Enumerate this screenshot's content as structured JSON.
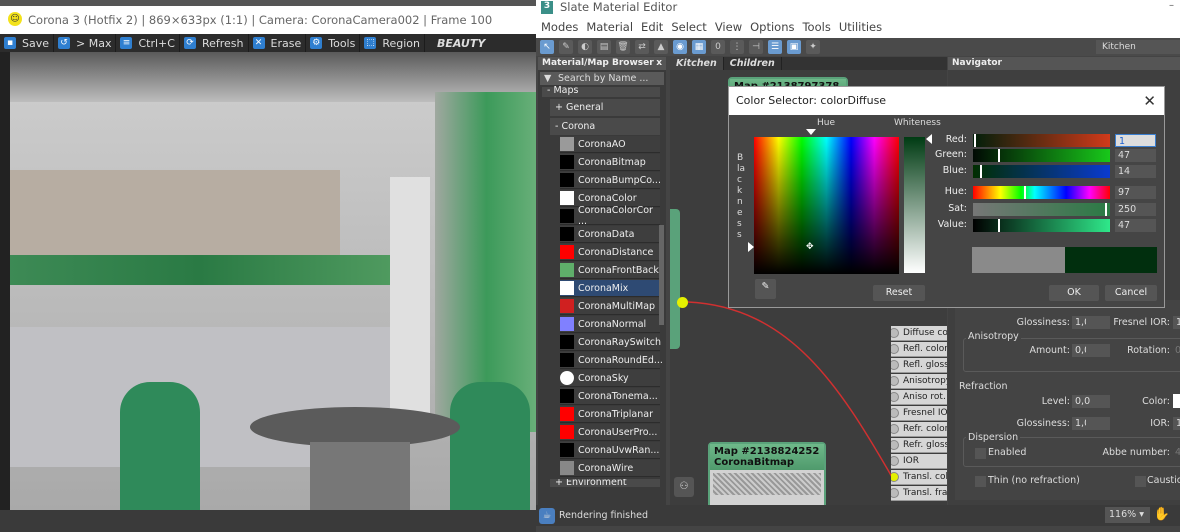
{
  "vfb": {
    "title": "Corona 3 (Hotfix 2) | 869×633px (1:1) | Camera: CoronaCamera002 | Frame 100",
    "toolbar": [
      {
        "label": "Save",
        "icon": "floppy-icon"
      },
      {
        "label": "> Max",
        "icon": "history-icon"
      },
      {
        "label": "Ctrl+C",
        "icon": "clipboard-icon"
      },
      {
        "label": "Refresh",
        "icon": "refresh-icon"
      },
      {
        "label": "Erase",
        "icon": "erase-icon"
      },
      {
        "label": "Tools",
        "icon": "gear-icon"
      },
      {
        "label": "Region",
        "icon": "region-icon"
      }
    ],
    "channel": "BEAUTY"
  },
  "sme": {
    "title": "Slate Material Editor",
    "menu": [
      "Modes",
      "Material",
      "Edit",
      "Select",
      "View",
      "Options",
      "Tools",
      "Utilities"
    ],
    "view_select": "Kitchen",
    "browser": {
      "title": "Material/Map Browser",
      "close": "x",
      "search_placeholder": "Search by Name ...",
      "maps": "- Maps",
      "general": "+ General",
      "corona": "- Corona",
      "environment": "+ Environment",
      "items": [
        {
          "label": "CoronaAO",
          "swatch": "#9a9a9a"
        },
        {
          "label": "CoronaBitmap",
          "swatch": "#000000"
        },
        {
          "label": "CoronaBumpCo...",
          "swatch": "#000000"
        },
        {
          "label": "CoronaColor",
          "swatch": "#ffffff"
        },
        {
          "label": "CoronaColorCor ...",
          "swatch": "#000000"
        },
        {
          "label": "CoronaData",
          "swatch": "#000000"
        },
        {
          "label": "CoronaDistance",
          "swatch": "#ff0000"
        },
        {
          "label": "CoronaFrontBack",
          "swatch": "#5fae6a"
        },
        {
          "label": "CoronaMix",
          "swatch": "#ffffff",
          "selected": true
        },
        {
          "label": "CoronaMultiMap",
          "swatch": "#d02020"
        },
        {
          "label": "CoronaNormal",
          "swatch": "#8080ff"
        },
        {
          "label": "CoronaRaySwitch",
          "swatch": "#000000"
        },
        {
          "label": "CoronaRoundEd...",
          "swatch": "#000000"
        },
        {
          "label": "CoronaSky",
          "swatch": "#ffffff"
        },
        {
          "label": "CoronaTonema...",
          "swatch": "#000000"
        },
        {
          "label": "CoronaTriplanar",
          "swatch": "#ff0000"
        },
        {
          "label": "CoronaUserPro...",
          "swatch": "#ff0000"
        },
        {
          "label": "CoronaUvwRan...",
          "swatch": "#000000"
        },
        {
          "label": "CoronaWire",
          "swatch": "#888888"
        }
      ]
    },
    "view_tabs": [
      "Kitchen",
      "Children"
    ],
    "nodes": [
      {
        "title": "Map #2138797378"
      },
      {
        "title": "Map #2138824252",
        "subtitle": "CoronaBitmap"
      }
    ],
    "navigator": "Navigator",
    "slots": [
      "Diffuse color",
      "Refl. color",
      "Refl. gloss.",
      "Anisotropy",
      "Aniso rot.",
      "Fresnel IOR",
      "Refr. color",
      "Refr. gloss.",
      "IOR",
      "Transl. color",
      "Transl. frac."
    ],
    "params": {
      "glossiness_label": "Glossiness:",
      "glossiness": "1,0",
      "fresnel_label": "Fresnel IOR:",
      "fresnel": "1,",
      "anisotropy": "Anisotropy",
      "amount_label": "Amount:",
      "amount": "0,0",
      "rotation_label": "Rotation:",
      "rotation": "0,",
      "refraction": "Refraction",
      "level_label": "Level:",
      "level": "0,0",
      "color_label": "Color:",
      "refr_gloss_label": "Glossiness:",
      "refr_gloss": "1,0",
      "ior_label": "IOR:",
      "ior": "1,",
      "dispersion": "Dispersion",
      "enabled": "Enabled",
      "abbe_label": "Abbe number:",
      "abbe": "4(",
      "thin": "Thin (no refraction)",
      "caustics": "Caustics"
    },
    "status": "Rendering finished",
    "zoom": "116%"
  },
  "color_selector": {
    "title": "Color Selector: colorDiffuse",
    "hue_label": "Hue",
    "whiteness_label": "Whiteness",
    "blackness_label": "Blackness",
    "channels": [
      {
        "label": "Red:",
        "value": "1",
        "max": 255
      },
      {
        "label": "Green:",
        "value": "47",
        "max": 255
      },
      {
        "label": "Blue:",
        "value": "14",
        "max": 255
      },
      {
        "label": "Hue:",
        "value": "97",
        "max": 255
      },
      {
        "label": "Sat:",
        "value": "250",
        "max": 255
      },
      {
        "label": "Value:",
        "value": "47",
        "max": 255
      }
    ],
    "old_color": "#8a8a8a",
    "new_color": "#012f0e",
    "reset": "Reset",
    "ok": "OK",
    "cancel": "Cancel"
  }
}
